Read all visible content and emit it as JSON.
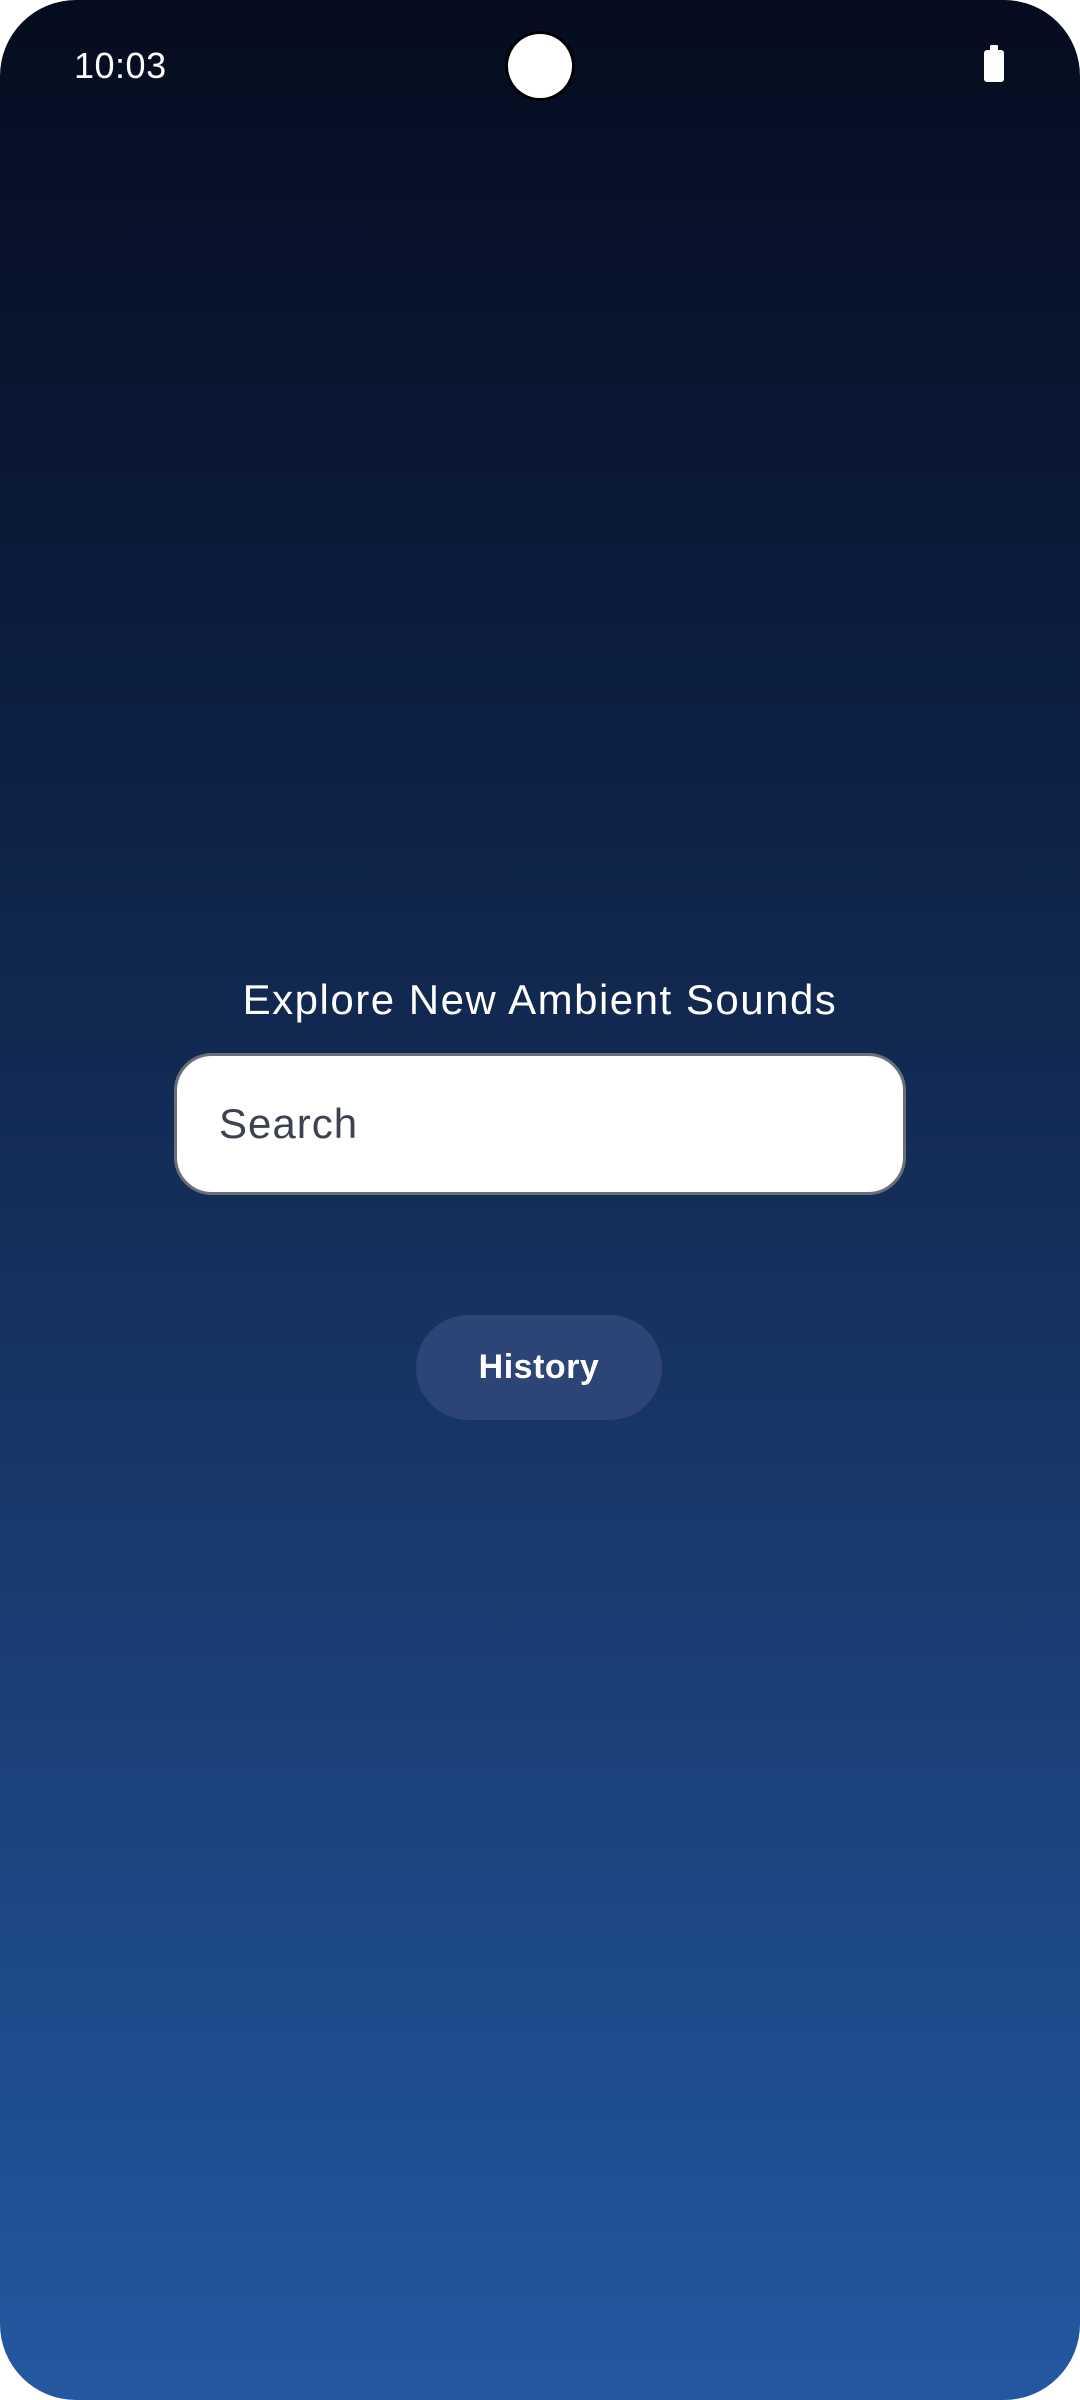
{
  "status_bar": {
    "time": "10:03",
    "battery_icon": "battery-icon",
    "camera_icon": "camera-cutout"
  },
  "main": {
    "headline": "Explore New Ambient Sounds",
    "search": {
      "placeholder": "Search",
      "value": ""
    },
    "history_button_label": "History"
  },
  "colors": {
    "gradient_top": "#050c1e",
    "gradient_bottom": "#2358a0",
    "history_button_bg": "#2d4576",
    "search_bg": "#ffffff",
    "text_light": "#ffffff",
    "search_text": "#3d4250"
  }
}
